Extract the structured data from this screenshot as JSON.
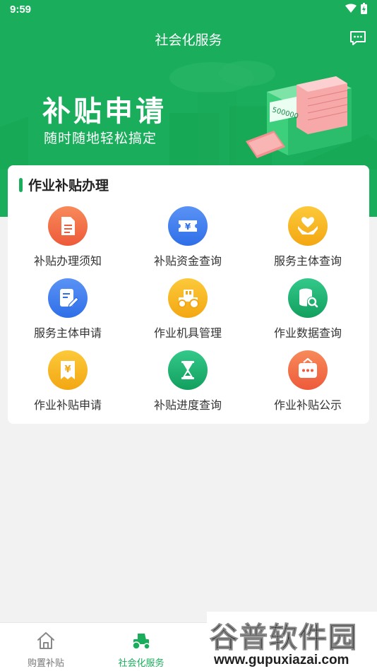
{
  "status": {
    "time": "9:59"
  },
  "header": {
    "title": "社会化服务"
  },
  "banner": {
    "title": "补贴申请",
    "subtitle": "随时随地轻松搞定",
    "machine_counter": "500000"
  },
  "section": {
    "title": "作业补贴办理",
    "items": [
      {
        "label": "补贴办理须知",
        "icon": "document-icon",
        "color": "#f26b43"
      },
      {
        "label": "补贴资金查询",
        "icon": "yuan-ticket-icon",
        "color": "#3f7ef0"
      },
      {
        "label": "服务主体查询",
        "icon": "heart-hands-icon",
        "color": "#f5b41a"
      },
      {
        "label": "服务主体申请",
        "icon": "edit-form-icon",
        "color": "#3f7ef0"
      },
      {
        "label": "作业机具管理",
        "icon": "tractor-icon",
        "color": "#f5b41a"
      },
      {
        "label": "作业数据查询",
        "icon": "database-search-icon",
        "color": "#1aae6a"
      },
      {
        "label": "作业补贴申请",
        "icon": "yuan-receipt-icon",
        "color": "#f5b41a"
      },
      {
        "label": "补贴进度查询",
        "icon": "hourglass-icon",
        "color": "#1aae6a"
      },
      {
        "label": "作业补贴公示",
        "icon": "notice-board-icon",
        "color": "#f26b43"
      }
    ]
  },
  "bottom_nav": {
    "items": [
      {
        "label": "购置补贴",
        "icon": "home-icon",
        "active": false
      },
      {
        "label": "社会化服务",
        "icon": "tractor-icon",
        "active": true
      }
    ]
  },
  "watermark": {
    "logo": "谷普软件园",
    "url": "www.gupuxiazai.com"
  },
  "colors": {
    "brand": "#1aae5c",
    "background": "#f2f2f2"
  }
}
